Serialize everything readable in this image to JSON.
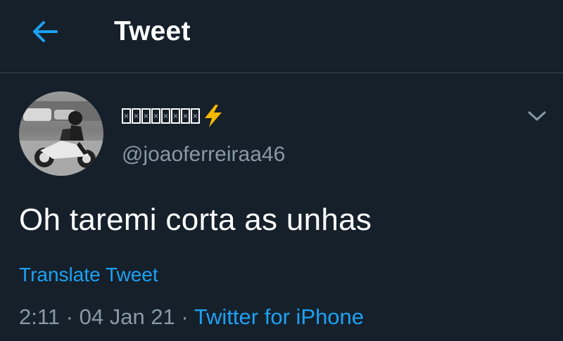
{
  "header": {
    "title": "Tweet",
    "back_icon": "arrow-left-icon",
    "accent_color": "#1da1f2"
  },
  "tweet": {
    "display_name_glyphs": "□□□□□□□□",
    "display_name_emoji": "⚡",
    "username": "@joaoferreiraa46",
    "text": "Oh taremi corta as unhas",
    "translate_label": "Translate Tweet",
    "time": "2:11",
    "date": "04 Jan 21",
    "separator": "·",
    "source": "Twitter for iPhone",
    "more_icon": "chevron-down-icon"
  },
  "theme": {
    "background": "#15202b",
    "border": "#38444d",
    "primary_text": "#ffffff",
    "secondary_text": "#8899a6",
    "link": "#1da1f2"
  }
}
